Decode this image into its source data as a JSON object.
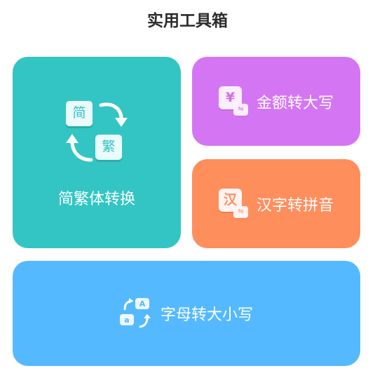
{
  "page": {
    "title": "实用工具箱"
  },
  "tools": {
    "jianfan": {
      "label": "简繁体转换",
      "icon_jian": "简",
      "icon_fan": "繁",
      "color": "#33c5c3"
    },
    "jine": {
      "label": "金额转大写",
      "icon_glyph": "¥",
      "color": "#d476f4"
    },
    "pinyin": {
      "label": "汉字转拼音",
      "icon_glyph": "汉",
      "color": "#ff8e5d"
    },
    "case": {
      "label": "字母转大小写",
      "icon_upper": "A",
      "icon_lower": "a",
      "color": "#55b9ff"
    }
  },
  "icons": {
    "swap_glyph": "⇋"
  }
}
